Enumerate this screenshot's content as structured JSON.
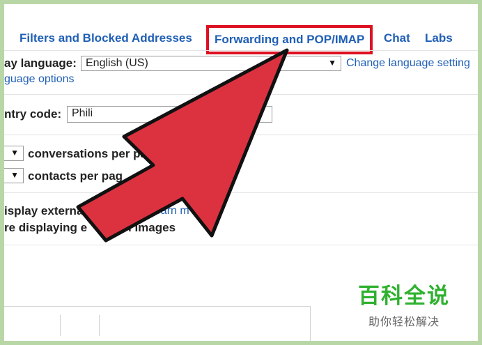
{
  "tabs": {
    "filters": "Filters and Blocked Addresses",
    "forwarding": "Forwarding and POP/IMAP",
    "chat": "Chat",
    "labs": "Labs"
  },
  "language": {
    "label": "ay language:",
    "selected": "English (US)",
    "change_link": "Change language setting",
    "more_link": "guage options"
  },
  "country": {
    "label": "ntry code:",
    "selected": "Phili"
  },
  "page_size": {
    "conversations_label": "conversations per pa",
    "contacts_label": "contacts per pag"
  },
  "images": {
    "line1": "isplay externa",
    "learn_more": "Learn m",
    "line2": "re displaying e",
    "line2_end": "l images"
  },
  "watermark": {
    "title": "百科全说",
    "subtitle": "助你轻松解决"
  },
  "colors": {
    "accent_red": "#dd1122",
    "arrow_fill": "#dc3240",
    "link_blue": "#1f5fb5",
    "brand_green": "#2fb12f"
  }
}
